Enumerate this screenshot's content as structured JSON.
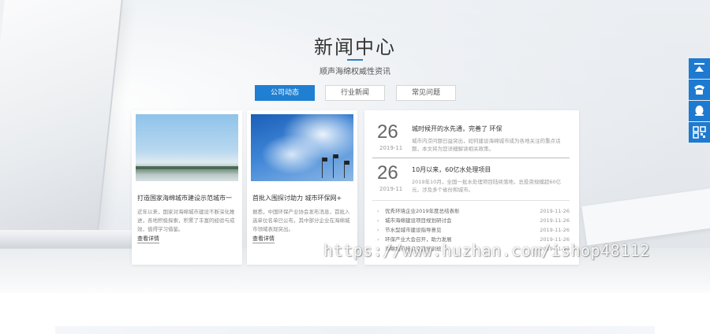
{
  "section": {
    "title": "新闻中心",
    "subtitle": "顺声海绵权威性资讯"
  },
  "tabs": [
    {
      "label": "公司动态",
      "active": true
    },
    {
      "label": "行业新闻",
      "active": false
    },
    {
      "label": "常见问题",
      "active": false
    }
  ],
  "cards": [
    {
      "title": "打造国家海绵城市建设示范城市一",
      "text": "近年以来，国家对海绵城市建设不断深化推进，各地积极探索，积累了丰富的经验与成效，值得学习借鉴。",
      "more": "查看详情"
    },
    {
      "title": "首批入围探讨助力 城市环保网+",
      "text": "据悉，中国环保产业协会发布消息，首批入选单位名单已公布，其中部分企业在海绵城市领域表现突出。",
      "more": "查看详情"
    }
  ],
  "featured": [
    {
      "day": "26",
      "ym": "2019-11",
      "title": "城时候开的水先通，完善了 环保",
      "text": "城市内涝问题日益突出，如何建设海绵城市成为各地关注的重点话题，本文将为您详细解读相关政策。"
    },
    {
      "day": "26",
      "ym": "2019-11",
      "title": "10月以来，60亿水处理项目",
      "text": "2019年10月，全国一批水处理项目陆续落地，总投资规模超60亿元，涉及多个省份和城市。"
    }
  ],
  "news_list": [
    {
      "title": "优秀环境企业2019年度总结表彰",
      "date": "2019-11-26"
    },
    {
      "title": "城市海绵建设项目规划研讨会",
      "date": "2019-11-26"
    },
    {
      "title": "节水型城市建设指导意见",
      "date": "2019-11-26"
    },
    {
      "title": "环保产业大会召开，助力发展",
      "date": "2019-11-26"
    },
    {
      "title": "海绵城市技术交流培训班",
      "date": "2019-11-26"
    }
  ],
  "sidebar": [
    {
      "icon": "back-to-top-icon"
    },
    {
      "icon": "phone-icon"
    },
    {
      "icon": "chat-icon"
    },
    {
      "icon": "qr-code-icon"
    }
  ],
  "watermark": "https://www.huzhan.com/ishop48112",
  "colors": {
    "accent": "#1f7fd2",
    "sidebar": "#1e7ad0"
  }
}
